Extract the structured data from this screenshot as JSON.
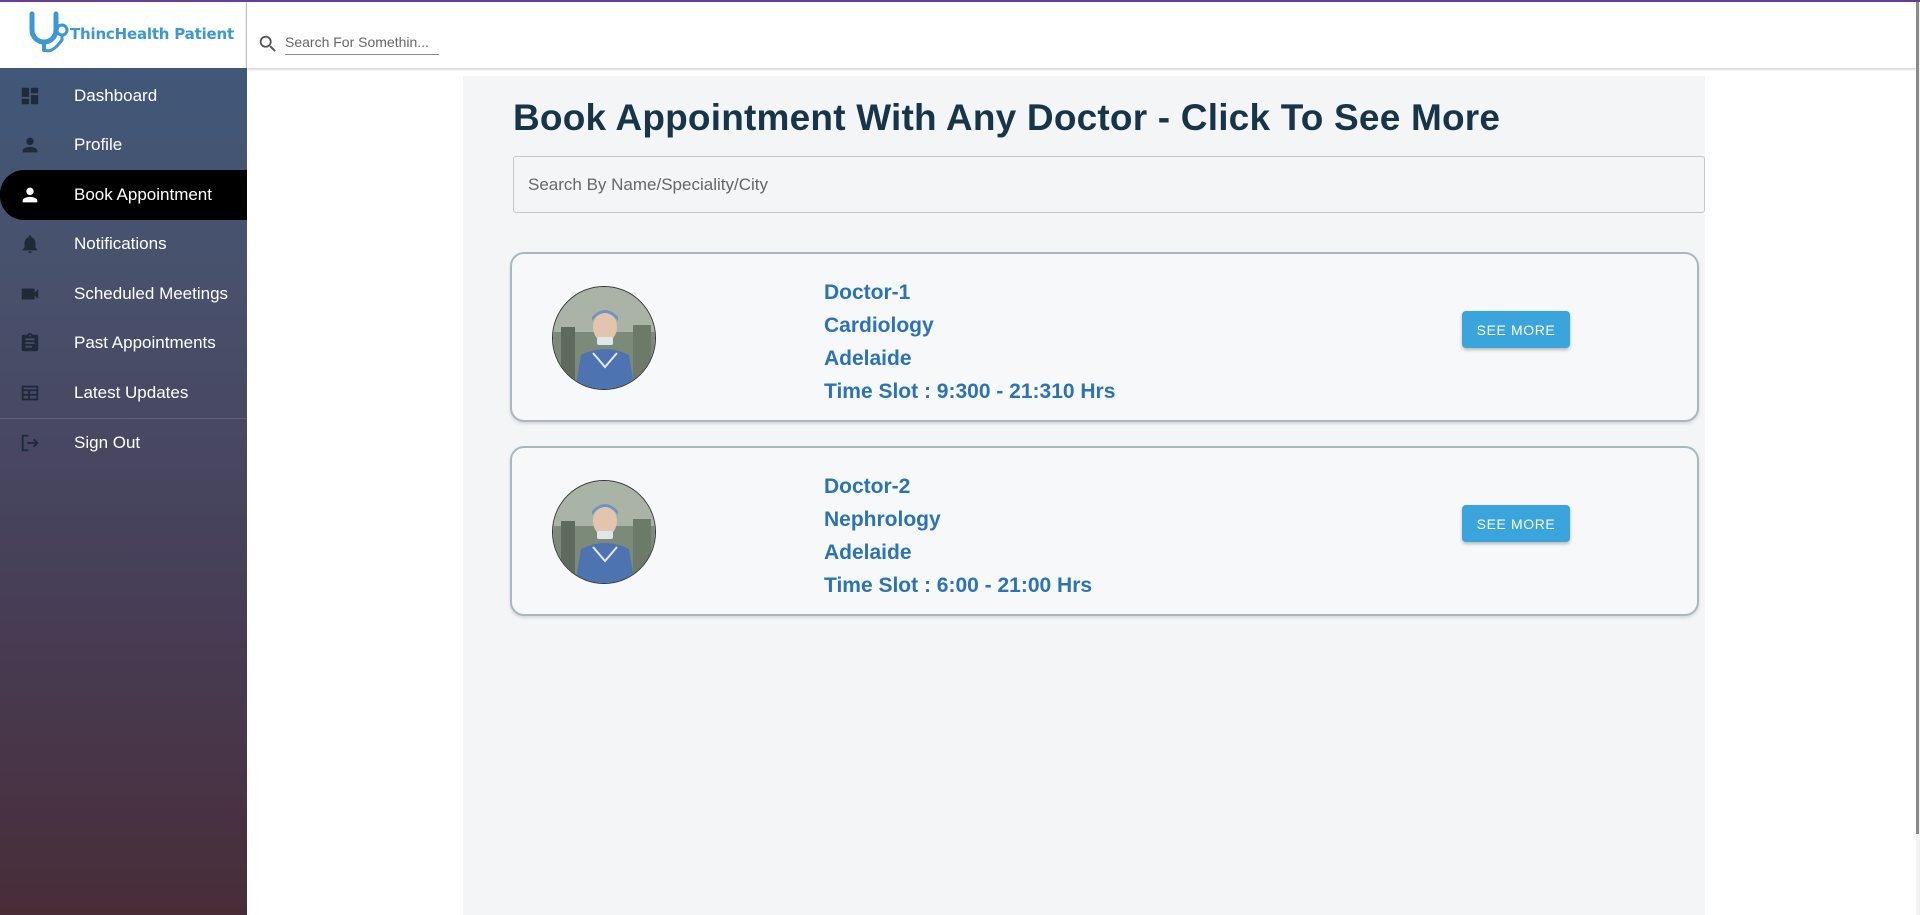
{
  "app": {
    "logo_text": "ThincHealth Patient",
    "brand_color": "#3a97d8",
    "accent_color": "#6a3d98"
  },
  "header": {
    "search_placeholder": "Search For Somethin..."
  },
  "sidebar": {
    "items": [
      {
        "label": "Dashboard",
        "icon": "dashboard-icon",
        "active": false
      },
      {
        "label": "Profile",
        "icon": "person-icon",
        "active": false
      },
      {
        "label": "Book Appointment",
        "icon": "person-icon",
        "active": true
      },
      {
        "label": "Notifications",
        "icon": "bell-icon",
        "active": false
      },
      {
        "label": "Scheduled Meetings",
        "icon": "video-camera-icon",
        "active": false
      },
      {
        "label": "Past Appointments",
        "icon": "clipboard-icon",
        "active": false
      },
      {
        "label": "Latest Updates",
        "icon": "table-icon",
        "active": false
      },
      {
        "label": "Sign Out",
        "icon": "sign-out-icon",
        "active": false
      }
    ]
  },
  "main": {
    "title": "Book Appointment With Any Doctor - Click To See More",
    "search_placeholder": "Search By Name/Speciality/City",
    "doctors": [
      {
        "name": "Doctor-1",
        "speciality": "Cardiology",
        "city": "Adelaide",
        "time_slot": "Time Slot : 9:300 - 21:310 Hrs",
        "button_label": "SEE MORE"
      },
      {
        "name": "Doctor-2",
        "speciality": "Nephrology",
        "city": "Adelaide",
        "time_slot": "Time Slot : 6:00 - 21:00 Hrs",
        "button_label": "SEE MORE"
      }
    ]
  }
}
